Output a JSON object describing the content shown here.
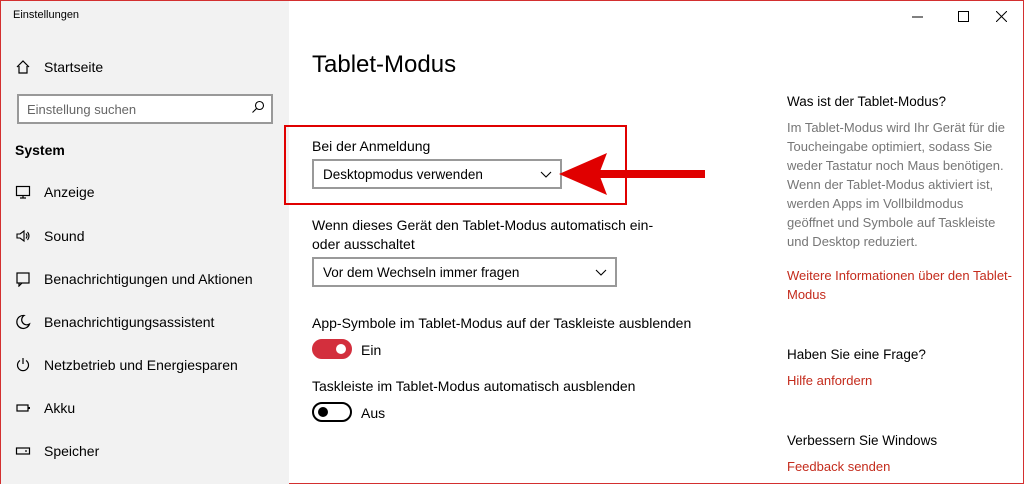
{
  "app": {
    "title": "Einstellungen"
  },
  "sidebar": {
    "home_label": "Startseite",
    "search_placeholder": "Einstellung suchen",
    "section": "System",
    "items": [
      {
        "label": "Anzeige",
        "icon": "monitor-icon"
      },
      {
        "label": "Sound",
        "icon": "speaker-icon"
      },
      {
        "label": "Benachrichtigungen und Aktionen",
        "icon": "message-icon"
      },
      {
        "label": "Benachrichtigungsassistent",
        "icon": "moon-icon"
      },
      {
        "label": "Netzbetrieb und Energiesparen",
        "icon": "power-icon"
      },
      {
        "label": "Akku",
        "icon": "battery-icon"
      },
      {
        "label": "Speicher",
        "icon": "storage-icon"
      }
    ]
  },
  "main": {
    "title": "Tablet-Modus",
    "signin": {
      "label": "Bei der Anmeldung",
      "value": "Desktopmodus verwenden"
    },
    "auto_switch": {
      "label": "Wenn dieses Gerät den Tablet-Modus automatisch ein- oder ausschaltet",
      "value": "Vor dem Wechseln immer fragen"
    },
    "hide_app_icons": {
      "label": "App-Symbole im Tablet-Modus auf der Taskleiste ausblenden",
      "state": "Ein",
      "on": true
    },
    "autohide_taskbar": {
      "label": "Taskleiste im Tablet-Modus automatisch ausblenden",
      "state": "Aus",
      "on": false
    }
  },
  "right": {
    "about_head": "Was ist der Tablet-Modus?",
    "about_text": "Im Tablet-Modus wird Ihr Gerät für die Toucheingabe optimiert, sodass Sie weder Tastatur noch Maus benötigen. Wenn der Tablet-Modus aktiviert ist, werden Apps im Vollbildmodus geöffnet und Symbole auf Taskleiste und Desktop reduziert.",
    "about_link": "Weitere Informationen über den Tablet-Modus",
    "question_head": "Haben Sie eine Frage?",
    "question_link": "Hilfe anfordern",
    "improve_head": "Verbessern Sie Windows",
    "improve_link": "Feedback senden"
  },
  "colors": {
    "accent": "#d32f3d",
    "link": "#c42b1c",
    "highlight": "#e00000"
  }
}
